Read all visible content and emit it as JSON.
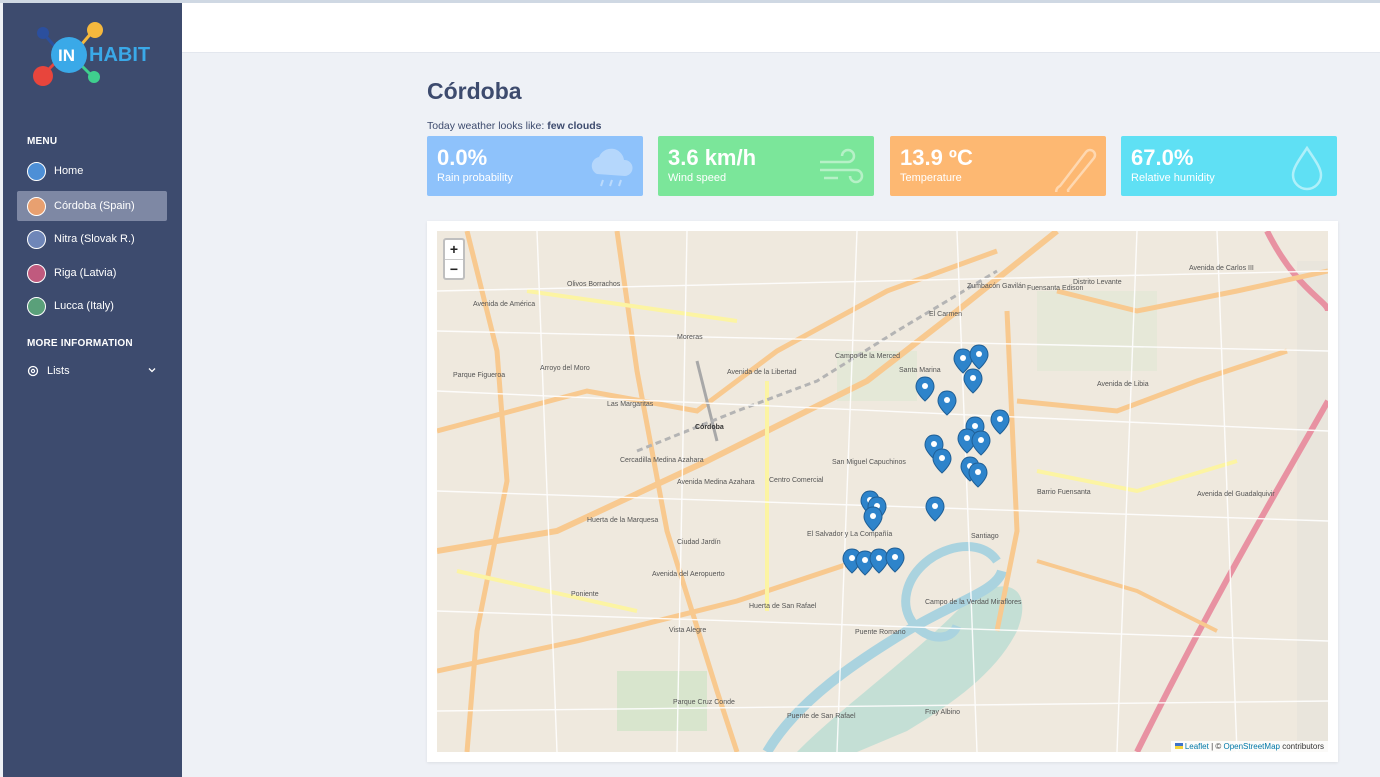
{
  "brand": {
    "logo_text_a": "IN",
    "logo_text_b": "HABIT"
  },
  "sidebar": {
    "menu_title": "MENU",
    "items": [
      {
        "label": "Home",
        "icon": "home-icon",
        "color": "#4d8fd6",
        "active": false
      },
      {
        "label": "Córdoba (Spain)",
        "icon": "cordoba-icon",
        "color": "#e8a070",
        "active": true
      },
      {
        "label": "Nitra (Slovak R.)",
        "icon": "nitra-icon",
        "color": "#6f86b8",
        "active": false
      },
      {
        "label": "Riga (Latvia)",
        "icon": "riga-icon",
        "color": "#c05a7e",
        "active": false
      },
      {
        "label": "Lucca (Italy)",
        "icon": "lucca-icon",
        "color": "#5aa07a",
        "active": false
      }
    ],
    "more_title": "MORE INFORMATION",
    "lists_label": "Lists"
  },
  "main": {
    "title": "Córdoba",
    "weather_prefix": "Today weather looks like: ",
    "weather_desc": "few clouds",
    "cards": [
      {
        "value": "0.0%",
        "label": "Rain probability",
        "color": "#8ec2fb",
        "icon": "cloud-rain-icon"
      },
      {
        "value": "3.6 km/h",
        "label": "Wind speed",
        "color": "#7be69a",
        "icon": "wind-icon"
      },
      {
        "value": "13.9 ºC",
        "label": "Temperature",
        "color": "#fdb872",
        "icon": "thermometer-icon"
      },
      {
        "value": "67.0%",
        "label": "Relative humidity",
        "color": "#5fe0f4",
        "icon": "droplet-icon"
      }
    ]
  },
  "map": {
    "zoom_in": "+",
    "zoom_out": "−",
    "attribution_leaflet": "Leaflet",
    "attribution_sep": " | © ",
    "attribution_osm": "OpenStreetMap",
    "attribution_tail": " contributors",
    "labels": [
      "Córdoba",
      "El Carmen",
      "Zumbacón Gavilán",
      "Fuensanta Edison",
      "Distrito Levante",
      "Olivos Borrachos",
      "Moreras",
      "Parque Figueroa",
      "Arroyo del Moro",
      "Las Margaritas",
      "Campo de la Merced",
      "Santa Marina",
      "Cercadilla Medina Azahara",
      "Centro Comercial",
      "San Miguel Capuchinos",
      "El Salvador y La Compañía",
      "Ciudad Jardín",
      "Huerta de la Marquesa",
      "Poniente",
      "Vista Alegre",
      "Santiago",
      "Barrio Fuensanta",
      "Campo de la Verdad Miraflores",
      "Puente Romano",
      "Fray Albino",
      "Puente de San Rafael",
      "Parque Cruz Conde",
      "Huerta de San Rafael",
      "Avenida de Carlos III",
      "Avenida de la Libertad",
      "Avenida de América",
      "Avenida Medina Azahara",
      "Avenida del Aeropuerto",
      "Avenida de Libia",
      "Avenida del Guadalquivir"
    ]
  }
}
